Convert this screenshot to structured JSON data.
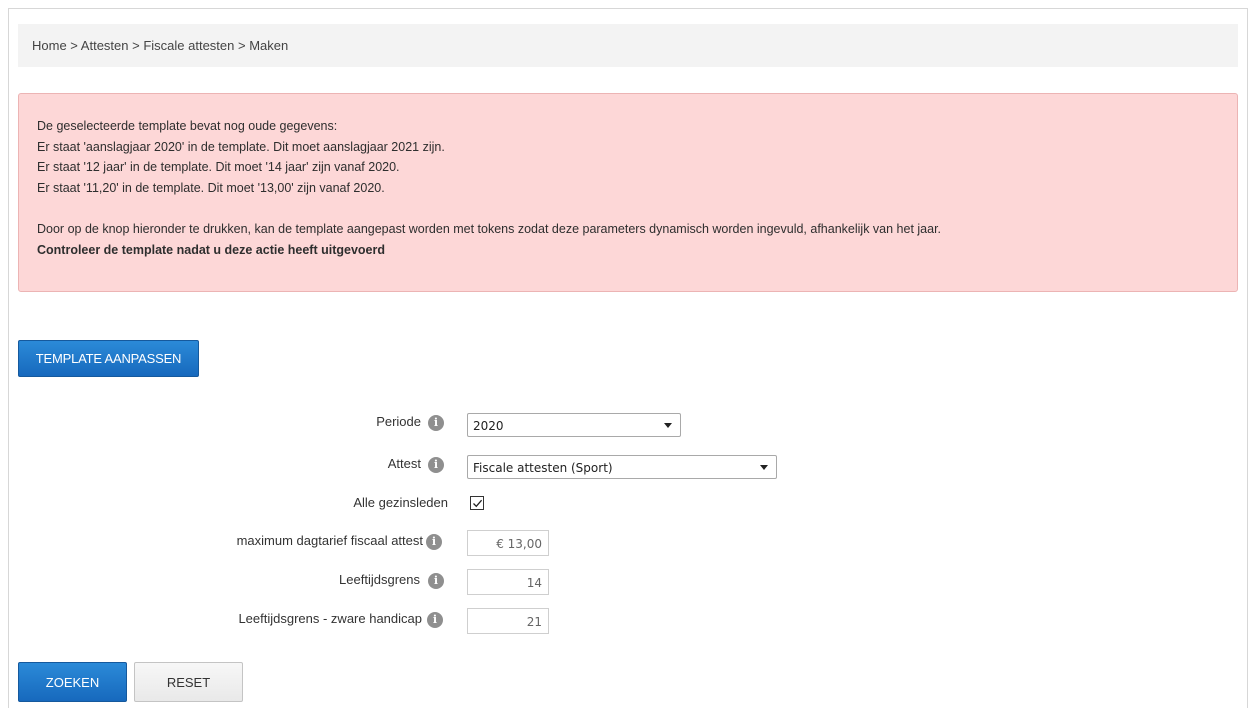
{
  "breadcrumb": {
    "items": [
      "Home",
      "Attesten",
      "Fiscale attesten",
      "Maken"
    ],
    "separator": " > "
  },
  "alert": {
    "lines": [
      "De geselecteerde template bevat nog oude gegevens:",
      "Er staat 'aanslagjaar 2020' in de template. Dit moet aanslagjaar 2021 zijn.",
      "Er staat '12 jaar' in de template. Dit moet '14 jaar' zijn vanaf 2020.",
      "Er staat '11,20' in de template. Dit moet '13,00' zijn vanaf 2020."
    ],
    "info": "Door op de knop hieronder te drukken, kan de template aangepast worden met tokens zodat deze parameters dynamisch worden ingevuld, afhankelijk van het jaar.",
    "warning": "Controleer de template nadat u deze actie heeft uitgevoerd"
  },
  "buttons": {
    "template_adjust": "TEMPLATE AANPASSEN",
    "search": "ZOEKEN",
    "reset": "RESET"
  },
  "form": {
    "periode": {
      "label": "Periode",
      "value": "2020"
    },
    "attest": {
      "label": "Attest",
      "value": "Fiscale attesten (Sport)"
    },
    "alle_gezinsleden": {
      "label": "Alle gezinsleden",
      "checked": true
    },
    "max_dagtarief": {
      "label": "maximum dagtarief fiscaal attest",
      "value": "€ 13,00"
    },
    "leeftijdsgrens": {
      "label": "Leeftijdsgrens",
      "value": "14"
    },
    "leeftijdsgrens_handicap": {
      "label": "Leeftijdsgrens - zware handicap",
      "value": "21"
    }
  },
  "icons": {
    "info": "info-icon",
    "dropdown": "caret-down-icon",
    "check": "checkmark-icon"
  },
  "colors": {
    "primary_button": "#1f79cc",
    "alert_background": "#fdd7d7",
    "alert_border": "#ecb4b4",
    "breadcrumb_background": "#f3f3f3"
  }
}
